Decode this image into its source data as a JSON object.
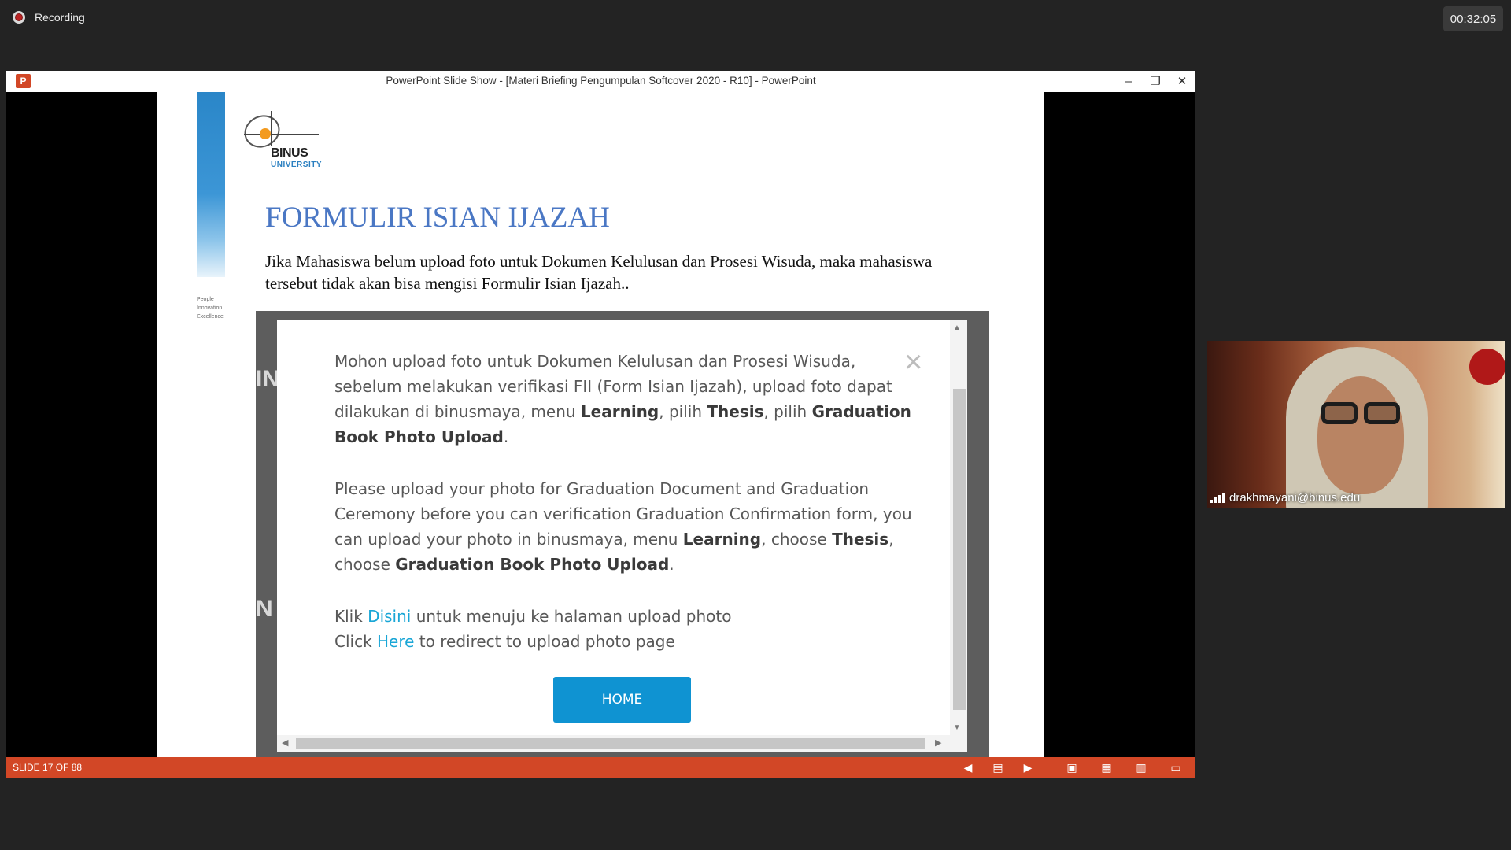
{
  "meeting": {
    "recording_label": "Recording",
    "elapsed_time": "00:32:05"
  },
  "window": {
    "app_icon": "P",
    "title": "PowerPoint Slide Show - [Materi Briefing Pengumpulan Softcover 2020 - R10] - PowerPoint",
    "minimize": "–",
    "restore": "❐",
    "close": "✕"
  },
  "slide": {
    "logo_name": "BINUS",
    "logo_sub": "UNIVERSITY",
    "tagline": [
      "People",
      "Innovation",
      "Excellence"
    ],
    "title": "FORMULIR ISIAN IJAZAH",
    "body": "Jika Mahasiswa belum upload foto untuk Dokumen Kelulusan dan Prosesi Wisuda, maka mahasiswa tersebut tidak akan bisa mengisi Formulir Isian Ijazah.."
  },
  "dialog": {
    "close_icon": "×",
    "home_button": "HOME",
    "link_id": "Disini",
    "link_en": "Here"
  },
  "statusbar": {
    "slide_counter": "SLIDE 17 OF 88",
    "accent": "#d24726"
  },
  "participant": {
    "email": "drakhmayani@binus.edu"
  }
}
